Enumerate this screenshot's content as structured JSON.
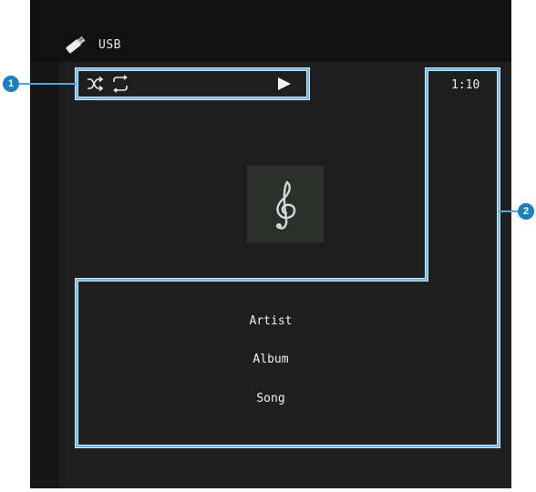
{
  "header": {
    "source_icon": "usb-stick-icon",
    "source_label": "USB"
  },
  "status": {
    "icons": [
      "shuffle-icon",
      "repeat-icon",
      "play-icon"
    ],
    "elapsed_time": "1:10"
  },
  "album_art": {
    "icon": "treble-clef-icon"
  },
  "track": {
    "artist": "Artist",
    "album": "Album",
    "song": "Song"
  },
  "callouts": {
    "one": "1",
    "two": "2",
    "color": "#5aaee6",
    "badge_color": "#1b7fc4"
  },
  "colors": {
    "screen_background": "#161616",
    "panel_background": "#1e1e1e",
    "text": "#f0f0f0"
  }
}
